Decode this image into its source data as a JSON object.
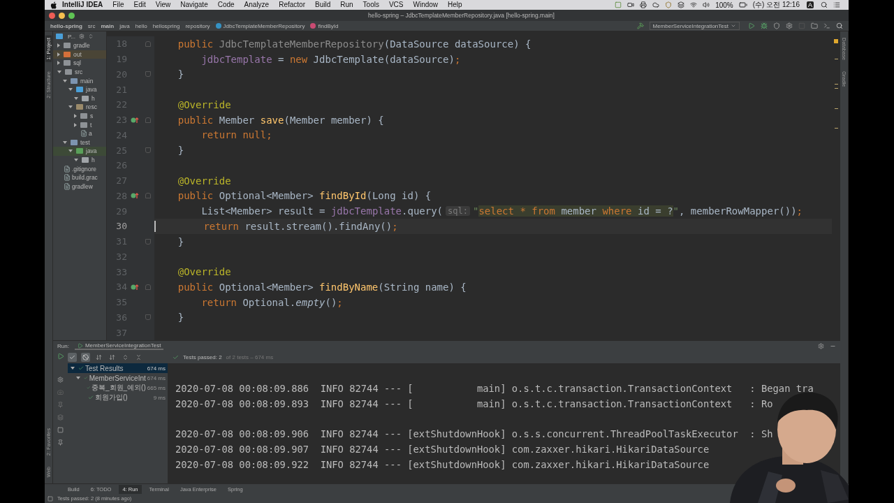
{
  "menubar": {
    "app": "IntelliJ IDEA",
    "menus": [
      "File",
      "Edit",
      "View",
      "Navigate",
      "Code",
      "Analyze",
      "Refactor",
      "Build",
      "Run",
      "Tools",
      "VCS",
      "Window",
      "Help"
    ],
    "battery": "100%",
    "clock": "(수) 오전 12:16",
    "input_source": "A"
  },
  "window": {
    "title": "hello-spring – JdbcTemplateMemberRepository.java [hello-spring.main]"
  },
  "breadcrumbs": [
    {
      "label": "hello-spring",
      "kind": "root"
    },
    {
      "label": "src",
      "kind": "folder"
    },
    {
      "label": "main",
      "kind": "root"
    },
    {
      "label": "java",
      "kind": "folder"
    },
    {
      "label": "hello",
      "kind": "folder"
    },
    {
      "label": "hellospring",
      "kind": "folder"
    },
    {
      "label": "repository",
      "kind": "folder"
    },
    {
      "label": "JdbcTemplateMemberRepository",
      "kind": "class"
    },
    {
      "label": "findById",
      "kind": "method"
    }
  ],
  "run_config": "MemberServiceIntegrationTest",
  "left_tabs_top": [
    {
      "label": "1: Project",
      "selected": true
    },
    {
      "label": "2: Structure",
      "selected": false
    }
  ],
  "left_tabs_bottom": [
    {
      "label": "2: Favorites",
      "selected": false
    },
    {
      "label": "Web",
      "selected": false
    }
  ],
  "right_tabs": [
    {
      "label": "Database"
    },
    {
      "label": "Gradle"
    }
  ],
  "project_panel": {
    "title": "P...",
    "tree": [
      {
        "label": "gradle",
        "kind": "folder",
        "expanded": false
      },
      {
        "label": "out",
        "kind": "excluded",
        "expanded": false
      },
      {
        "label": "sql",
        "kind": "folder",
        "expanded": false
      },
      {
        "label": "src",
        "kind": "folder",
        "expanded": true,
        "children": [
          {
            "label": "main",
            "kind": "module",
            "expanded": true,
            "children": [
              {
                "label": "java",
                "kind": "source",
                "expanded": true,
                "children": [
                  {
                    "label": "h",
                    "kind": "package",
                    "expanded": true
                  }
                ]
              },
              {
                "label": "resc",
                "kind": "resource",
                "expanded": true,
                "children": [
                  {
                    "label": "s",
                    "kind": "folder",
                    "expanded": false
                  },
                  {
                    "label": "t",
                    "kind": "folder",
                    "expanded": false
                  },
                  {
                    "label": "a",
                    "kind": "file"
                  }
                ]
              }
            ]
          },
          {
            "label": "test",
            "kind": "module",
            "expanded": true,
            "children": [
              {
                "label": "java",
                "kind": "test",
                "expanded": true,
                "children": [
                  {
                    "label": "h",
                    "kind": "package",
                    "expanded": true
                  }
                ]
              }
            ]
          }
        ]
      },
      {
        "label": ".gitignore",
        "kind": "file"
      },
      {
        "label": "build.grac",
        "kind": "file"
      },
      {
        "label": "gradlew",
        "kind": "file"
      }
    ]
  },
  "editor": {
    "lines": [
      {
        "number": "18",
        "current": false,
        "fold_start": true,
        "fold_end": false,
        "implemented": false,
        "tokens": [
          {
            "text": "    public ",
            "kind": "kw"
          },
          {
            "text": "JdbcTemplateMemberRepository",
            "kind": "dim"
          },
          {
            "text": "(DataSource dataSource) {",
            "kind": "plain"
          }
        ]
      },
      {
        "number": "19",
        "current": false,
        "fold_start": false,
        "fold_end": false,
        "implemented": false,
        "tokens": [
          {
            "text": "        jdbcTemplate",
            "kind": "field"
          },
          {
            "text": " = ",
            "kind": "plain"
          },
          {
            "text": "new",
            "kind": "kw"
          },
          {
            "text": " JdbcTemplate(dataSource)",
            "kind": "plain"
          },
          {
            "text": ";",
            "kind": "kw"
          }
        ]
      },
      {
        "number": "20",
        "current": false,
        "fold_start": false,
        "fold_end": true,
        "implemented": false,
        "tokens": [
          {
            "text": "    }",
            "kind": "plain"
          }
        ]
      },
      {
        "number": "21",
        "current": false,
        "fold_start": false,
        "fold_end": false,
        "implemented": false
      },
      {
        "number": "22",
        "current": false,
        "fold_start": false,
        "fold_end": false,
        "implemented": false,
        "tokens": [
          {
            "text": "    @Override",
            "kind": "annot"
          }
        ]
      },
      {
        "number": "23",
        "current": false,
        "fold_start": true,
        "fold_end": false,
        "implemented": true,
        "tokens": [
          {
            "text": "    public",
            "kind": "kw"
          },
          {
            "text": " Member ",
            "kind": "plain"
          },
          {
            "text": "save",
            "kind": "decl"
          },
          {
            "text": "(Member member) {",
            "kind": "plain"
          }
        ]
      },
      {
        "number": "24",
        "current": false,
        "fold_start": false,
        "fold_end": false,
        "implemented": false,
        "tokens": [
          {
            "text": "        return null;",
            "kind": "kw"
          }
        ]
      },
      {
        "number": "25",
        "current": false,
        "fold_start": false,
        "fold_end": true,
        "implemented": false,
        "tokens": [
          {
            "text": "    }",
            "kind": "plain"
          }
        ]
      },
      {
        "number": "26",
        "current": false,
        "fold_start": false,
        "fold_end": false,
        "implemented": false
      },
      {
        "number": "27",
        "current": false,
        "fold_start": false,
        "fold_end": false,
        "implemented": false,
        "tokens": [
          {
            "text": "    @Override",
            "kind": "annot"
          }
        ]
      },
      {
        "number": "28",
        "current": false,
        "fold_start": true,
        "fold_end": false,
        "implemented": true,
        "tokens": [
          {
            "text": "    public",
            "kind": "kw"
          },
          {
            "text": " Optional<Member> ",
            "kind": "plain"
          },
          {
            "text": "findById",
            "kind": "decl"
          },
          {
            "text": "(Long id) {",
            "kind": "plain"
          }
        ]
      },
      {
        "number": "29",
        "current": false,
        "fold_start": false,
        "fold_end": false,
        "implemented": false,
        "tokens": [
          {
            "text": "        List<Member> result = ",
            "kind": "plain"
          },
          {
            "text": "jdbcTemplate",
            "kind": "field"
          },
          {
            "text": ".query(",
            "kind": "plain"
          },
          {
            "text": "sql:",
            "kind": "hint"
          },
          {
            "text": "\"",
            "kind": "str"
          },
          {
            "text": "select * from",
            "kind": "sqlkw"
          },
          {
            "text": " member ",
            "kind": "sql"
          },
          {
            "text": "where",
            "kind": "sqlkw"
          },
          {
            "text": " id = ?",
            "kind": "sql"
          },
          {
            "text": "\"",
            "kind": "str"
          },
          {
            "text": ", memberRowMapper())",
            "kind": "plain"
          },
          {
            "text": ";",
            "kind": "kw"
          }
        ]
      },
      {
        "number": "30",
        "current": true,
        "fold_start": false,
        "fold_end": false,
        "implemented": false,
        "tokens": [
          {
            "text": "        return",
            "kind": "kw"
          },
          {
            "text": " result.stream().findAny()",
            "kind": "plain"
          },
          {
            "text": ";",
            "kind": "kw"
          }
        ]
      },
      {
        "number": "31",
        "current": false,
        "fold_start": false,
        "fold_end": true,
        "implemented": false,
        "tokens": [
          {
            "text": "    }",
            "kind": "plain"
          }
        ]
      },
      {
        "number": "32",
        "current": false,
        "fold_start": false,
        "fold_end": false,
        "implemented": false
      },
      {
        "number": "33",
        "current": false,
        "fold_start": false,
        "fold_end": false,
        "implemented": false,
        "tokens": [
          {
            "text": "    @Override",
            "kind": "annot"
          }
        ]
      },
      {
        "number": "34",
        "current": false,
        "fold_start": true,
        "fold_end": false,
        "implemented": true,
        "tokens": [
          {
            "text": "    public",
            "kind": "kw"
          },
          {
            "text": " Optional<Member> ",
            "kind": "plain"
          },
          {
            "text": "findByName",
            "kind": "decl"
          },
          {
            "text": "(String name) {",
            "kind": "plain"
          }
        ]
      },
      {
        "number": "35",
        "current": false,
        "fold_start": false,
        "fold_end": false,
        "implemented": false,
        "tokens": [
          {
            "text": "        return",
            "kind": "kw"
          },
          {
            "text": " Optional.",
            "kind": "plain"
          },
          {
            "text": "empty",
            "kind": "static"
          },
          {
            "text": "()",
            "kind": "plain"
          },
          {
            "text": ";",
            "kind": "kw"
          }
        ]
      },
      {
        "number": "36",
        "current": false,
        "fold_start": false,
        "fold_end": true,
        "implemented": false,
        "tokens": [
          {
            "text": "    }",
            "kind": "plain"
          }
        ]
      },
      {
        "number": "37",
        "current": false,
        "fold_start": false,
        "fold_end": false,
        "implemented": false
      }
    ]
  },
  "run_panel": {
    "label": "Run:",
    "tab": "MemberServiceIntegrationTest",
    "status": "Tests passed: 2",
    "status_detail": "of 2 tests – 674 ms",
    "tests": [
      {
        "label": "Test Results",
        "duration": "674 ms",
        "passed": true,
        "selected": true,
        "expanded": true,
        "children": [
          {
            "label": "MemberServiceInt",
            "duration": "674 ms",
            "passed": true,
            "selected": false,
            "expanded": true,
            "children": [
              {
                "label": "중복_회원_예외()",
                "duration": "665 ms",
                "passed": true,
                "selected": false
              },
              {
                "label": "회원가입()",
                "duration": "9 ms",
                "passed": true,
                "selected": false
              }
            ]
          }
        ]
      }
    ],
    "log": [
      {
        "text": "2020-07-08 00:08:09.886  INFO 82744 --- [           main] o.s.t.c.transaction.TransactionContext   : Began tra",
        "gap_before": false
      },
      {
        "text": "2020-07-08 00:08:09.893  INFO 82744 --- [           main] o.s.t.c.transaction.TransactionContext   : Ro",
        "gap_before": false
      },
      {
        "text": "2020-07-08 00:08:09.906  INFO 82744 --- [extShutdownHook] o.s.s.concurrent.ThreadPoolTaskExecutor  : Sh",
        "gap_before": true
      },
      {
        "text": "2020-07-08 00:08:09.907  INFO 82744 --- [extShutdownHook] com.zaxxer.hikari.HikariDataSource",
        "gap_before": false
      },
      {
        "text": "2020-07-08 00:08:09.922  INFO 82744 --- [extShutdownHook] com.zaxxer.hikari.HikariDataSource",
        "gap_before": false
      }
    ]
  },
  "tool_tabs": [
    {
      "label": "Build",
      "selected": false
    },
    {
      "label": "6: TODO",
      "selected": false
    },
    {
      "label": "4: Run",
      "selected": true
    },
    {
      "label": "Terminal",
      "selected": false
    },
    {
      "label": "Java Enterprise",
      "selected": false
    },
    {
      "label": "Spring",
      "selected": false
    }
  ],
  "status_bar": {
    "message": "Tests passed: 2 (8 minutes ago)"
  }
}
